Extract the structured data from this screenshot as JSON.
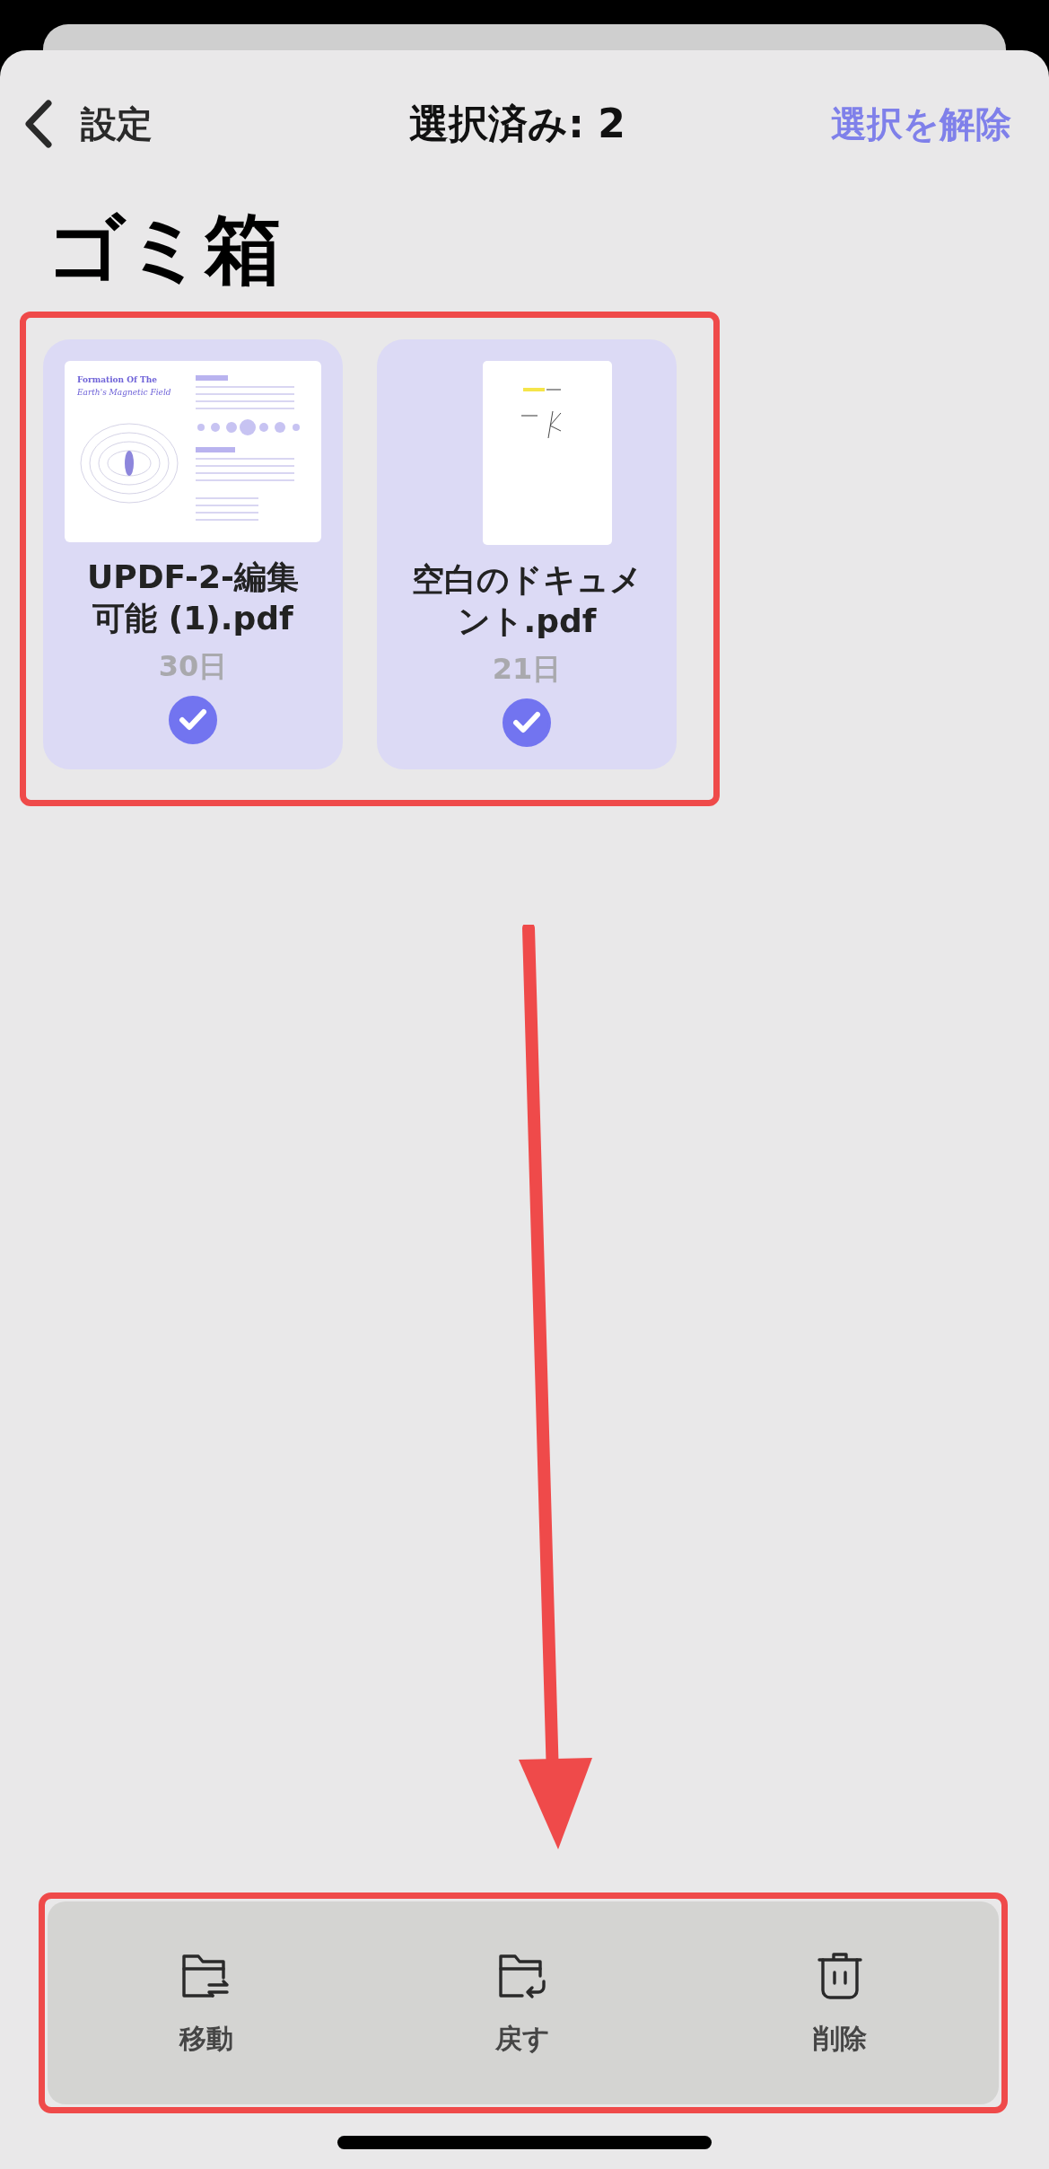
{
  "header": {
    "back_label": "設定",
    "title": "選択済み: 2",
    "action": "選択を解除"
  },
  "page_title": "ゴミ箱",
  "files": [
    {
      "name": "UPDF-2-編集可能 (1).pdf",
      "days": "30日",
      "selected": true,
      "thumbnail": {
        "kind": "article",
        "title_lines": [
          "Formation Of The",
          "Earth's Magnetic Field"
        ]
      }
    },
    {
      "name": "空白のドキュメント.pdf",
      "days": "21日",
      "selected": true,
      "thumbnail": {
        "kind": "sketch"
      }
    }
  ],
  "toolbar": [
    {
      "kind": "move",
      "label": "移動"
    },
    {
      "kind": "restore",
      "label": "戻す"
    },
    {
      "kind": "delete",
      "label": "削除"
    }
  ]
}
